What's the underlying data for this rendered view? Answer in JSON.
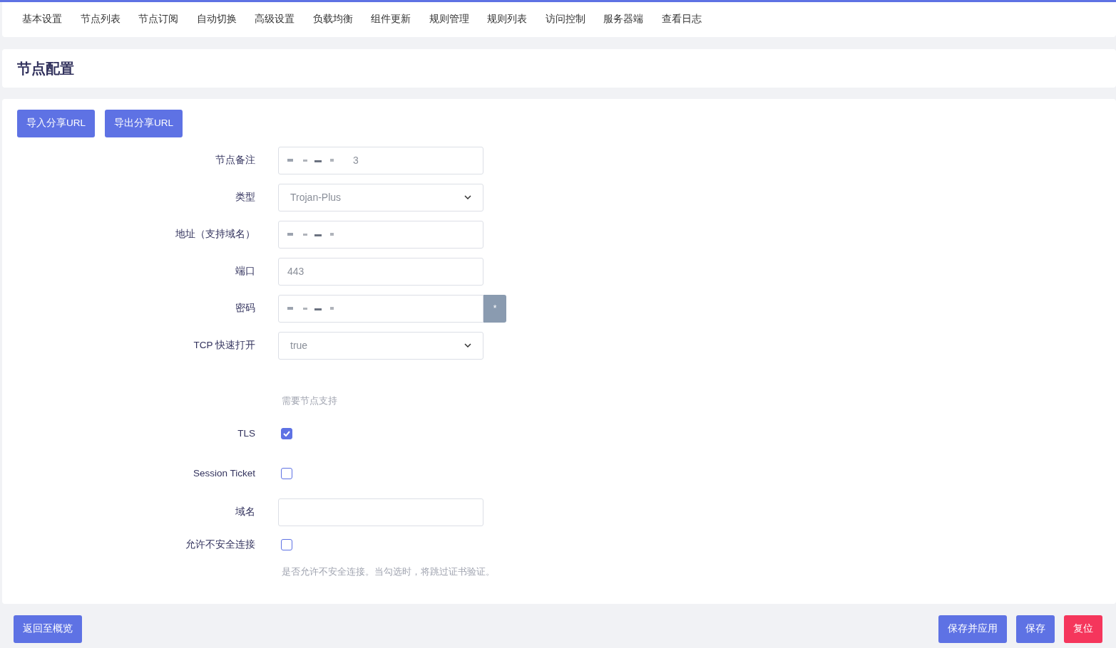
{
  "nav_tabs": [
    {
      "label": "基本设置"
    },
    {
      "label": "节点列表"
    },
    {
      "label": "节点订阅"
    },
    {
      "label": "自动切换"
    },
    {
      "label": "高级设置"
    },
    {
      "label": "负载均衡"
    },
    {
      "label": "组件更新"
    },
    {
      "label": "规则管理"
    },
    {
      "label": "规则列表"
    },
    {
      "label": "访问控制"
    },
    {
      "label": "服务器端"
    },
    {
      "label": "查看日志"
    }
  ],
  "page_title": "节点配置",
  "top_buttons": [
    "导入分享URL",
    "导出分享URL"
  ],
  "form": [
    {
      "kind": "text",
      "label": "节点备注",
      "value": "3",
      "redacted": true
    },
    {
      "kind": "select",
      "label": "类型",
      "value": "Trojan-Plus"
    },
    {
      "kind": "text",
      "label": "地址（支持域名）",
      "redacted": true
    },
    {
      "kind": "text",
      "label": "端口",
      "value": "443"
    },
    {
      "kind": "password",
      "label": "密码",
      "reveal": "*",
      "redacted": true
    },
    {
      "kind": "select",
      "label": "TCP 快速打开",
      "value": "true",
      "hint": "需要节点支持"
    },
    {
      "kind": "checkbox",
      "label": "TLS",
      "checked": true
    },
    {
      "kind": "checkbox",
      "label": "Session Ticket",
      "checked": false
    },
    {
      "kind": "text",
      "label": "域名"
    },
    {
      "kind": "checkbox",
      "label": "允许不安全连接",
      "checked": false,
      "hint": "是否允许不安全连接。当勾选时，将跳过证书验证。"
    }
  ],
  "footer": {
    "back": "返回至概览",
    "actions": [
      {
        "label": "保存并应用",
        "kind": "primary"
      },
      {
        "label": "保存",
        "kind": "primary"
      },
      {
        "label": "复位",
        "kind": "danger"
      }
    ]
  }
}
